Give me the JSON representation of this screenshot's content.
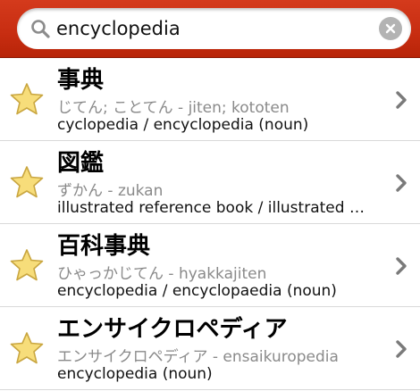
{
  "search": {
    "value": "encyclopedia",
    "clear_icon": "clear-x-icon",
    "search_icon": "magnifier-icon"
  },
  "colors": {
    "bar_red": "#c72d11",
    "star_fill": "#f7dd7a",
    "reading_gray": "#8a8a8a"
  },
  "results": [
    {
      "headword": "事典",
      "reading": "じてん; ことてん - jiten; kototen",
      "gloss": "cyclopedia / encyclopedia (noun)"
    },
    {
      "headword": "図鑑",
      "reading": "ずかん - zukan",
      "gloss": "illustrated reference book / illustrated encyclopedia"
    },
    {
      "headword": "百科事典",
      "reading": "ひゃっかじてん - hyakkajiten",
      "gloss": "encyclopedia / encyclopaedia (noun)"
    },
    {
      "headword": "エンサイクロペディア",
      "reading": "エンサイクロペディア - ensaikuropedia",
      "gloss": "encyclopedia (noun)"
    }
  ]
}
